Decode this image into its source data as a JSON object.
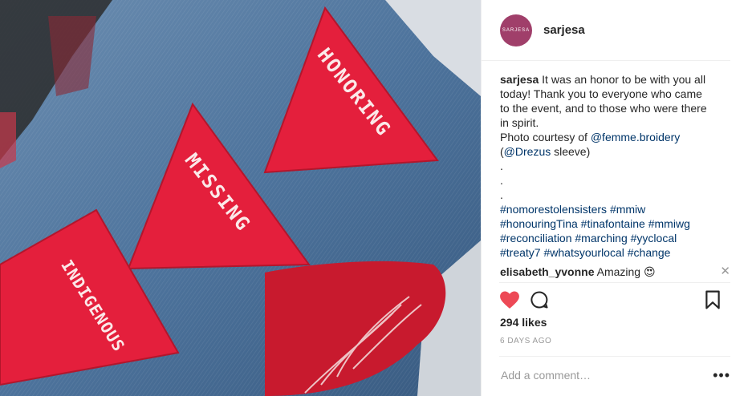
{
  "post": {
    "username": "sarjesa",
    "avatar_text": "SARJESA",
    "caption": {
      "line1": "It was an honor to be with you all",
      "line2": "today! Thank you to everyone who came",
      "line3": "to the event, and to those who were there",
      "line4": "in spirit.",
      "photo_line_a": "Photo courtesy of ",
      "mention1": "@femme.broidery",
      "paren_open": "(",
      "mention2": "@Drezus",
      "paren_close": " sleeve)",
      "dot": ".",
      "hashtags1": "#nomorestolensisters #mmiw",
      "hashtags2": "#honouringTina #tinafontaine #mmiwg",
      "hashtags3": "#reconciliation #marching #yyclocal",
      "hashtags4": "#treaty7 #whatsyourlocal #change"
    },
    "comment": {
      "user": "elisabeth_yvonne",
      "text": "Amazing 😍",
      "close": "✕"
    },
    "likes": "294 likes",
    "time_ago": "6 DAYS AGO",
    "add_comment_placeholder": "Add a comment…",
    "more": "•••"
  },
  "photo": {
    "patch1": "HONORING",
    "patch2": "MISSING",
    "patch3": "INDIGENOUS"
  },
  "colors": {
    "heart": "#ed4956",
    "link": "#003569",
    "denim": "#4a6f97",
    "patch": "#e41f3c"
  },
  "icons": [
    "heart-icon",
    "comment-icon",
    "bookmark-icon",
    "close-icon",
    "more-icon"
  ]
}
